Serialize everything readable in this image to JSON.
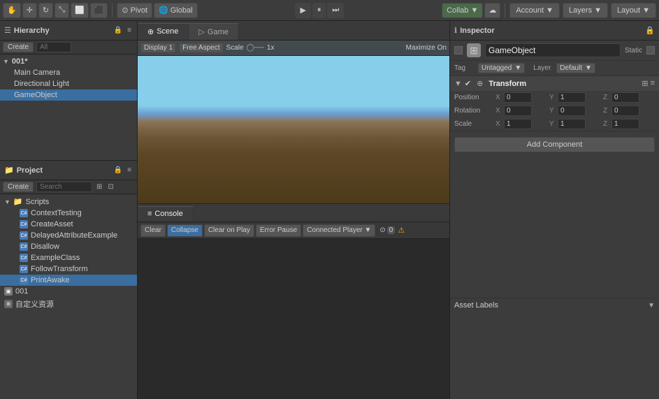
{
  "toolbar": {
    "pivot_label": "Pivot",
    "global_label": "Global",
    "play_icon": "▶",
    "pause_icon": "⏸",
    "step_icon": "⏭",
    "collab_label": "Collab ▼",
    "cloud_icon": "☁",
    "account_label": "Account ▼",
    "layers_label": "Layers ▼",
    "layout_label": "Layout ▼",
    "hand_icon": "✋",
    "move_icon": "✛",
    "rotate_icon": "↻",
    "scale_icon": "⤡",
    "rect_icon": "⬜",
    "transform_icon": "⬛"
  },
  "hierarchy": {
    "title": "Hierarchy",
    "create_label": "Create",
    "all_label": "All",
    "scene_name": "001*",
    "items": [
      {
        "name": "Main Camera",
        "indent": 1
      },
      {
        "name": "Directional Light",
        "indent": 1
      },
      {
        "name": "GameObject",
        "indent": 1,
        "selected": true
      }
    ]
  },
  "project": {
    "title": "Project",
    "create_label": "Create",
    "folders": [
      {
        "name": "Scripts",
        "type": "folder",
        "expanded": true
      },
      {
        "name": "ContextTesting",
        "type": "script",
        "indent": 1
      },
      {
        "name": "CreateAsset",
        "type": "script",
        "indent": 1
      },
      {
        "name": "DelayedAttributeExample",
        "type": "script",
        "indent": 1
      },
      {
        "name": "Disallow",
        "type": "script",
        "indent": 1
      },
      {
        "name": "ExampleClass",
        "type": "script",
        "indent": 1
      },
      {
        "name": "FollowTransform",
        "type": "script",
        "indent": 1
      },
      {
        "name": "PrintAwake",
        "type": "script",
        "indent": 1,
        "selected": true
      },
      {
        "name": "001",
        "type": "asset",
        "indent": 0
      },
      {
        "name": "自定义资源",
        "type": "asset",
        "indent": 0
      }
    ]
  },
  "scene": {
    "title": "Scene",
    "display_label": "Display 1",
    "aspect_label": "Free Aspect",
    "scale_label": "Scale",
    "scale_value": "1x",
    "maximize_label": "Maximize On"
  },
  "game": {
    "title": "Game"
  },
  "console": {
    "title": "Console",
    "clear_label": "Clear",
    "collapse_label": "Collapse",
    "clear_on_play_label": "Clear on Play",
    "error_pause_label": "Error Pause",
    "connected_player_label": "Connected Player ▼",
    "count_icon": "⊙",
    "count_value": "0",
    "warning_icon": "⚠"
  },
  "inspector": {
    "title": "Inspector",
    "lock_icon": "🔒",
    "gameobject": {
      "name": "GameObject",
      "static_label": "Static",
      "tag_label": "Tag",
      "tag_value": "Untagged",
      "layer_label": "Layer",
      "layer_value": "Default"
    },
    "transform": {
      "title": "Transform",
      "position_label": "Position",
      "rotation_label": "Rotation",
      "scale_label": "Scale",
      "x_label": "X",
      "y_label": "Y",
      "z_label": "Z",
      "position": {
        "x": "0",
        "y": "1",
        "z": "0"
      },
      "rotation": {
        "x": "0",
        "y": "0",
        "z": "0"
      },
      "scale": {
        "x": "1",
        "y": "1",
        "z": "1"
      }
    },
    "add_component_label": "Add Component",
    "asset_labels_label": "Asset Labels"
  }
}
